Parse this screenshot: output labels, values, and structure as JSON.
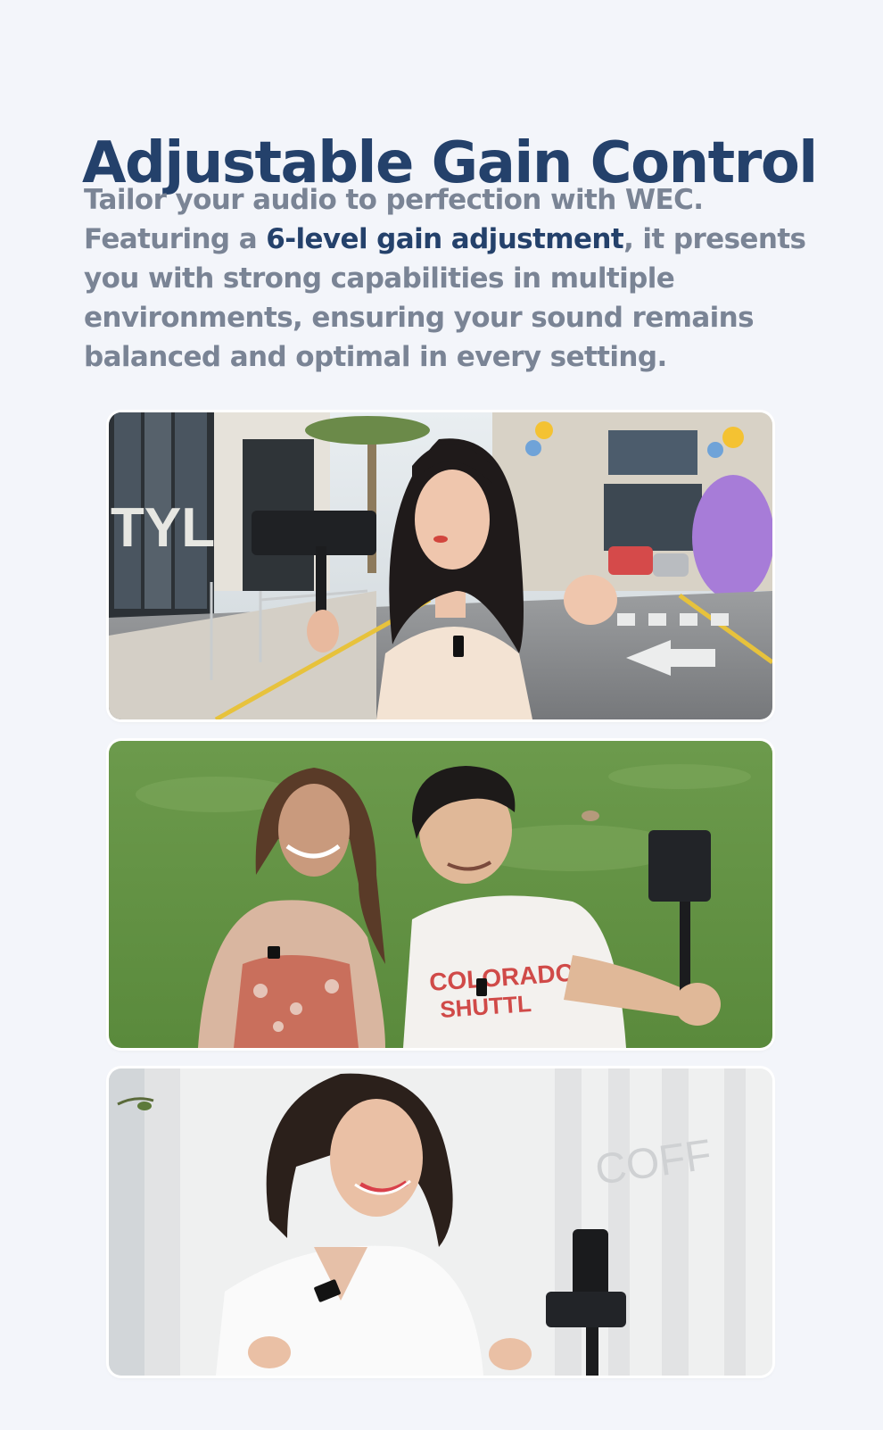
{
  "heading": "Adjustable Gain Control",
  "description": {
    "line1": "Tailor your audio to perfection with WEC.",
    "pre_highlight": "Featuring a ",
    "highlight": "6-level gain adjustment",
    "post_highlight": ", it presents you with strong capabilities in multiple environments, ensuring your sound remains balanced and optimal in every setting."
  },
  "photos": [
    {
      "scene": "street-vlogging",
      "sign_text": "TYLE"
    },
    {
      "scene": "park-interview",
      "shirt_text_1": "COLORADO",
      "shirt_text_2": "SHUTTL"
    },
    {
      "scene": "indoor-vlogging",
      "wall_text": "COFF"
    }
  ],
  "colors": {
    "background": "#f3f5fa",
    "heading": "#24416b",
    "body_text": "#7a8495",
    "highlight": "#24416b"
  }
}
